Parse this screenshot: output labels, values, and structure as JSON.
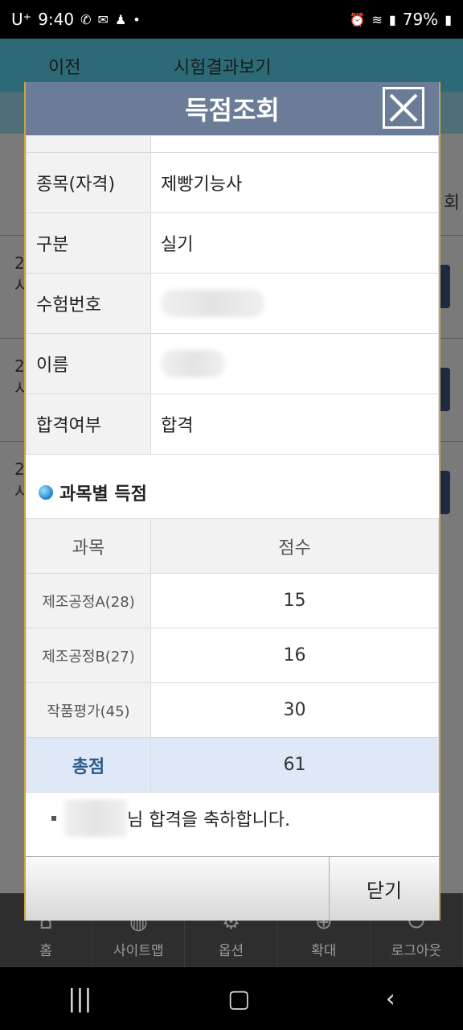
{
  "status": {
    "carrier": "U⁺",
    "time": "9:40",
    "battery": "79%"
  },
  "background": {
    "prev_label": "이전",
    "title": "시험결과보기",
    "col_label": "회",
    "rows": [
      {
        "num": "2",
        "sub": "시"
      },
      {
        "num": "2",
        "sub": "시"
      },
      {
        "num": "2",
        "sub": "시"
      }
    ]
  },
  "modal": {
    "title": "득점조회",
    "info": [
      {
        "key": "종목(자격)",
        "value": "제빵기능사"
      },
      {
        "key": "구분",
        "value": "실기"
      },
      {
        "key": "수험번호",
        "value": ""
      },
      {
        "key": "이름",
        "value": ""
      },
      {
        "key": "합격여부",
        "value": "합격"
      }
    ],
    "section_title": "과목별 득점",
    "score_headers": [
      "과목",
      "점수"
    ],
    "scores": [
      {
        "subject": "제조공정A(28)",
        "score": "15"
      },
      {
        "subject": "제조공정B(27)",
        "score": "16"
      },
      {
        "subject": "작품평가(45)",
        "score": "30"
      }
    ],
    "total": {
      "label": "총점",
      "score": "61"
    },
    "congrats_text": "님 합격을 축하합니다.",
    "close_label": "닫기"
  },
  "bottom_nav": [
    {
      "icon": "home-icon",
      "label": "홈"
    },
    {
      "icon": "globe-icon",
      "label": "사이트맵"
    },
    {
      "icon": "gear-icon",
      "label": "옵션"
    },
    {
      "icon": "plus-icon",
      "label": "확대"
    },
    {
      "icon": "power-icon",
      "label": "로그아웃"
    }
  ],
  "colors": {
    "modal_header": "#6b7c99",
    "total_row": "#dfe8f7",
    "total_label": "#2a5a8a"
  }
}
